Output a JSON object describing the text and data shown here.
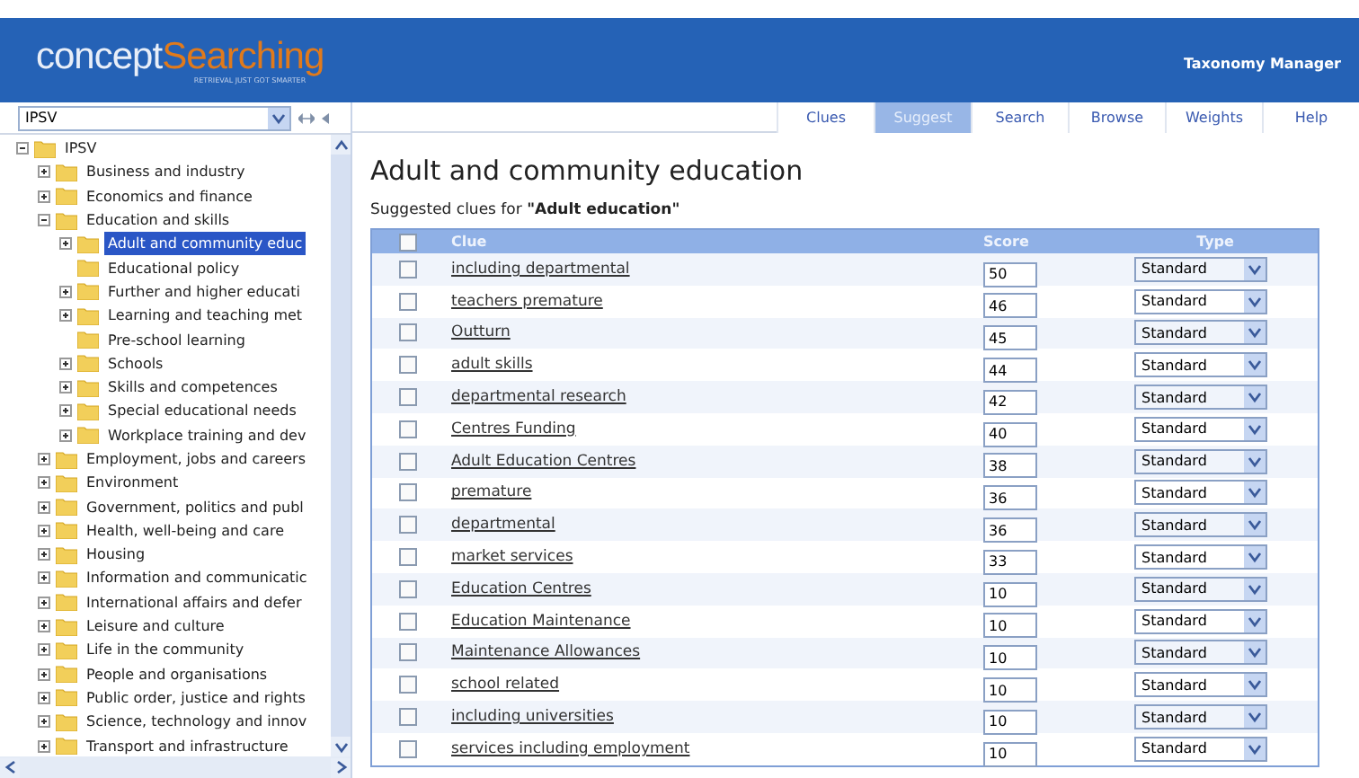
{
  "header": {
    "logo_main": "concept",
    "logo_accent": "Searching",
    "tagline": "RETRIEVAL JUST GOT SMARTER",
    "app_title": "Taxonomy Manager"
  },
  "taxonomy_select": {
    "value": "IPSV"
  },
  "tabs": [
    {
      "label": "Clues",
      "selected": false
    },
    {
      "label": "Suggest",
      "selected": true
    },
    {
      "label": "Search",
      "selected": false
    },
    {
      "label": "Browse",
      "selected": false
    },
    {
      "label": "Weights",
      "selected": false
    },
    {
      "label": "Help",
      "selected": false
    }
  ],
  "tree": [
    {
      "label": "IPSV",
      "kind": "branch",
      "expanded": true,
      "selected": false,
      "children": [
        {
          "label": "Business and industry",
          "kind": "branch",
          "expanded": false,
          "selected": false
        },
        {
          "label": "Economics and finance",
          "kind": "branch",
          "expanded": false,
          "selected": false
        },
        {
          "label": "Education and skills",
          "kind": "branch",
          "expanded": true,
          "selected": false,
          "children": [
            {
              "label": "Adult and community educ",
              "kind": "branch",
              "expanded": false,
              "selected": true
            },
            {
              "label": "Educational policy",
              "kind": "leaf",
              "selected": false
            },
            {
              "label": "Further and higher educati",
              "kind": "branch",
              "expanded": false,
              "selected": false
            },
            {
              "label": "Learning and teaching met",
              "kind": "branch",
              "expanded": false,
              "selected": false
            },
            {
              "label": "Pre-school learning",
              "kind": "leaf",
              "selected": false
            },
            {
              "label": "Schools",
              "kind": "branch",
              "expanded": false,
              "selected": false
            },
            {
              "label": "Skills and competences",
              "kind": "branch",
              "expanded": false,
              "selected": false
            },
            {
              "label": "Special educational needs",
              "kind": "branch",
              "expanded": false,
              "selected": false
            },
            {
              "label": "Workplace training and dev",
              "kind": "branch",
              "expanded": false,
              "selected": false
            }
          ]
        },
        {
          "label": "Employment, jobs and careers",
          "kind": "branch",
          "expanded": false,
          "selected": false
        },
        {
          "label": "Environment",
          "kind": "branch",
          "expanded": false,
          "selected": false
        },
        {
          "label": "Government, politics and publ",
          "kind": "branch",
          "expanded": false,
          "selected": false
        },
        {
          "label": "Health, well-being and care",
          "kind": "branch",
          "expanded": false,
          "selected": false
        },
        {
          "label": "Housing",
          "kind": "branch",
          "expanded": false,
          "selected": false
        },
        {
          "label": "Information and communicatic",
          "kind": "branch",
          "expanded": false,
          "selected": false
        },
        {
          "label": "International affairs and defer",
          "kind": "branch",
          "expanded": false,
          "selected": false
        },
        {
          "label": "Leisure and culture",
          "kind": "branch",
          "expanded": false,
          "selected": false
        },
        {
          "label": "Life in the community",
          "kind": "branch",
          "expanded": false,
          "selected": false
        },
        {
          "label": "People and organisations",
          "kind": "branch",
          "expanded": false,
          "selected": false
        },
        {
          "label": "Public order, justice and rights",
          "kind": "branch",
          "expanded": false,
          "selected": false
        },
        {
          "label": "Science, technology and innov",
          "kind": "branch",
          "expanded": false,
          "selected": false
        },
        {
          "label": "Transport and infrastructure",
          "kind": "branch",
          "expanded": false,
          "selected": false
        }
      ]
    }
  ],
  "page_title": "Adult and community education",
  "subtitle_prefix": "Suggested clues for",
  "subtitle_term": "\"Adult education\"",
  "table": {
    "select_all_checked": false,
    "columns": [
      "Clue",
      "Score",
      "Type"
    ],
    "rows": [
      {
        "checked": false,
        "clue": "including departmental",
        "score": "50",
        "type": "Standard"
      },
      {
        "checked": false,
        "clue": "teachers premature",
        "score": "46",
        "type": "Standard"
      },
      {
        "checked": false,
        "clue": "Outturn",
        "score": "45",
        "type": "Standard"
      },
      {
        "checked": false,
        "clue": "adult skills",
        "score": "44",
        "type": "Standard"
      },
      {
        "checked": false,
        "clue": "departmental research",
        "score": "42",
        "type": "Standard"
      },
      {
        "checked": false,
        "clue": "Centres Funding",
        "score": "40",
        "type": "Standard"
      },
      {
        "checked": false,
        "clue": "Adult Education Centres",
        "score": "38",
        "type": "Standard"
      },
      {
        "checked": false,
        "clue": "premature",
        "score": "36",
        "type": "Standard"
      },
      {
        "checked": false,
        "clue": "departmental",
        "score": "36",
        "type": "Standard"
      },
      {
        "checked": false,
        "clue": "market services",
        "score": "33",
        "type": "Standard"
      },
      {
        "checked": false,
        "clue": "Education Centres",
        "score": "10",
        "type": "Standard"
      },
      {
        "checked": false,
        "clue": "Education Maintenance",
        "score": "10",
        "type": "Standard"
      },
      {
        "checked": false,
        "clue": "Maintenance Allowances",
        "score": "10",
        "type": "Standard"
      },
      {
        "checked": false,
        "clue": "school related",
        "score": "10",
        "type": "Standard"
      },
      {
        "checked": false,
        "clue": "including universities",
        "score": "10",
        "type": "Standard"
      },
      {
        "checked": false,
        "clue": "services including employment",
        "score": "10",
        "type": "Standard"
      }
    ]
  }
}
